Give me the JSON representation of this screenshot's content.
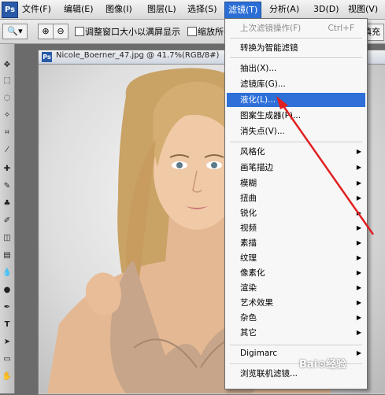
{
  "menubar": {
    "logo": "Ps",
    "items": [
      "文件(F)",
      "编辑(E)",
      "图像(I)",
      "图层(L)",
      "选择(S)",
      "滤镜(T)",
      "分析(A)",
      "3D(D)",
      "视图(V)"
    ]
  },
  "options": {
    "check1": "调整窗口大小以满屏显示",
    "check2": "缩放所有",
    "fill_button": "填充"
  },
  "document": {
    "title": "Nicole_Boerner_47.jpg @ 41.7%(RGB/8#)"
  },
  "filter_menu": {
    "last_filter": "上次滤镜操作(F)",
    "last_filter_shortcut": "Ctrl+F",
    "smart": "转换为智能滤镜",
    "extract": "抽出(X)...",
    "gallery": "滤镜库(G)...",
    "liquify": "液化(L)...",
    "pattern": "图案生成器(P)...",
    "vanishing": "消失点(V)...",
    "submenus": [
      "风格化",
      "画笔描边",
      "模糊",
      "扭曲",
      "锐化",
      "视频",
      "素描",
      "纹理",
      "像素化",
      "渲染",
      "艺术效果",
      "杂色",
      "其它"
    ],
    "digimarc": "Digimarc",
    "browse": "浏览联机滤镜..."
  },
  "watermark": "Bai⊙经验",
  "colors": {
    "highlight": "#2f6fd8",
    "arrow": "#e02020"
  }
}
